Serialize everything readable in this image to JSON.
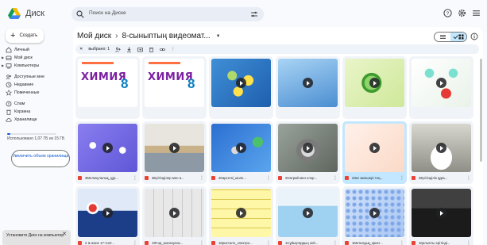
{
  "app": {
    "title": "Диск"
  },
  "search": {
    "placeholder": "Поиск на Диске"
  },
  "sidebar": {
    "create_label": "Создать",
    "items": [
      {
        "label": "Личный",
        "icon": "home-icon"
      },
      {
        "label": "Мой диск",
        "icon": "drive-icon"
      },
      {
        "label": "Компьютеры",
        "icon": "computer-icon"
      },
      {
        "label": "Доступные мне",
        "icon": "shared-icon"
      },
      {
        "label": "Недавние",
        "icon": "clock-icon"
      },
      {
        "label": "Помеченные",
        "icon": "star-icon"
      },
      {
        "label": "Спам",
        "icon": "spam-icon"
      },
      {
        "label": "Корзина",
        "icon": "trash-icon"
      },
      {
        "label": "Хранилище",
        "icon": "cloud-icon"
      }
    ],
    "quota_text": "Использовано 1,07 ГБ из 15 ГБ",
    "quota_fraction": 0.07,
    "upgrade_label": "Увеличить объем хранилища",
    "install_toast": "Установите Диск на компьютер"
  },
  "breadcrumb": {
    "root": "Мой диск",
    "separator": "›",
    "current": "8-сыныптың видеомат..."
  },
  "selection_bar": {
    "label": "выбрано: 1"
  },
  "files": [
    {
      "name": "",
      "thumb": "book",
      "book_title": "ХИМИЯ",
      "book_grade": "8"
    },
    {
      "name": "",
      "thumb": "book",
      "book_title": "ХИМИЯ",
      "book_grade": "8"
    },
    {
      "name": "",
      "thumb": "molecule-yellow"
    },
    {
      "name": "",
      "thumb": "sky-blue"
    },
    {
      "name": "",
      "thumb": "green-sphere"
    },
    {
      "name": "",
      "thumb": "atoms-colored"
    },
    {
      "name": "3Молекулалық_құр...",
      "thumb": "violet-molecules",
      "selected": false
    },
    {
      "name": "3Ерітінділер мен ө...",
      "thumb": "paint-cans",
      "selected": false
    },
    {
      "name": "2Көрсеткі_моле...",
      "thumb": "hcl-molecule",
      "selected": false
    },
    {
      "name": "2Натрий мен хлор...",
      "thumb": "grey-sphere",
      "selected": false
    },
    {
      "name": "2Зат мөлшері тең...",
      "thumb": "formula-cn",
      "selected": true
    },
    {
      "name": "2Ерітінділік құра...",
      "thumb": "white-powder",
      "selected": false
    },
    {
      "name": "2 Ік және 17-топт...",
      "thumb": "periodic-atom",
      "selected": false
    },
    {
      "name": "1Фтор_молекулас...",
      "thumb": "periodic-grey",
      "selected": false
    },
    {
      "name": "1Кристалл_электро...",
      "thumb": "periodic-yellow",
      "selected": false
    },
    {
      "name": "1Сұйықтардың хей...",
      "thumb": "beaker-blue",
      "selected": false
    },
    {
      "name": "1Металдық_крист...",
      "thumb": "crystal-lattice",
      "selected": false
    },
    {
      "name": "1Қалыпты ерітінді...",
      "thumb": "scales-dark",
      "selected": false
    }
  ]
}
